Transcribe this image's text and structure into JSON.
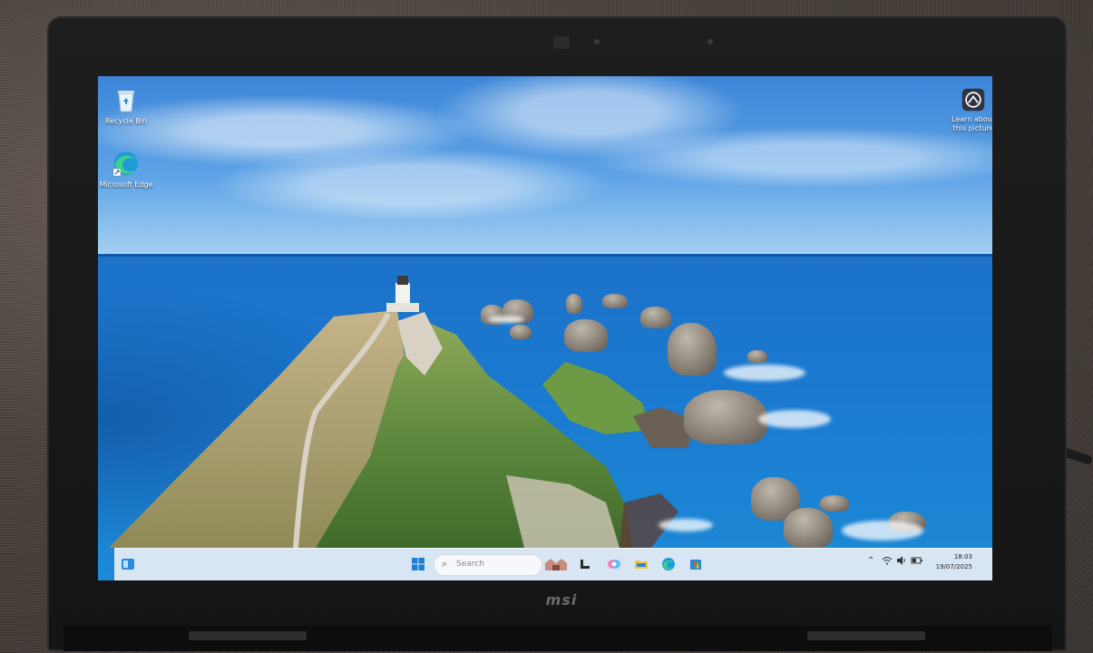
{
  "desktop": {
    "icons": [
      {
        "label": "Recycle Bin",
        "icon": "recycle-bin-icon"
      },
      {
        "label": "Microsoft Edge",
        "icon": "edge-icon"
      }
    ],
    "spotlight": {
      "label": "Learn about this picture",
      "icon": "spotlight-icon"
    }
  },
  "taskbar": {
    "search_placeholder": "Search",
    "pinned": [
      "widgets-icon",
      "start-icon",
      "search-icon",
      "task-view-icon",
      "copilot-icon",
      "file-explorer-icon",
      "edge-icon",
      "store-icon"
    ],
    "tray": {
      "icons": [
        "chevron-up-icon",
        "wifi-icon",
        "volume-icon",
        "battery-icon"
      ],
      "time": "18:03",
      "date": "19/07/2025"
    }
  },
  "device": {
    "brand": "msi"
  },
  "colors": {
    "taskbar": "#e8eef5",
    "accent": "#0f6cbd",
    "sea": "#1a79cf"
  }
}
